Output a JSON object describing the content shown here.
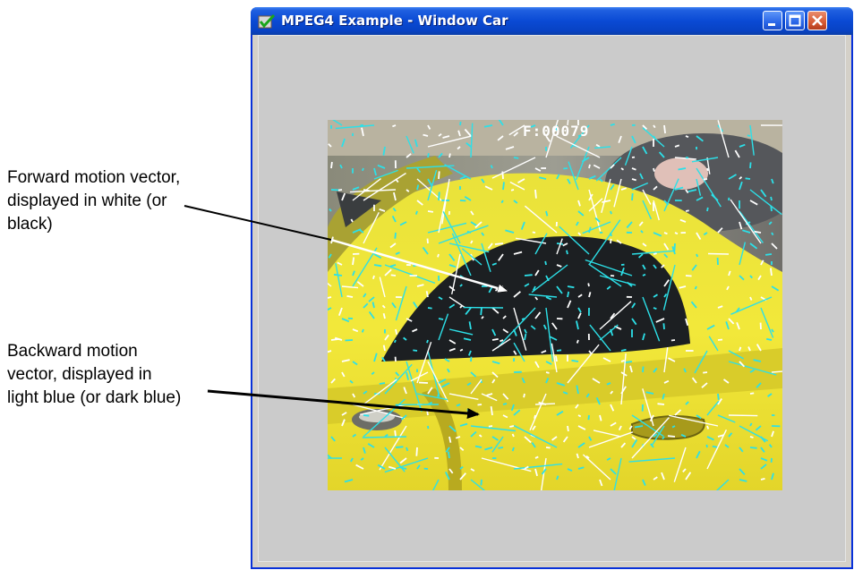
{
  "window": {
    "title": "MPEG4 Example - Window Car",
    "icon": "app-checkmark-icon",
    "buttons": [
      "minimize-icon",
      "maximize-icon",
      "close-icon"
    ]
  },
  "video": {
    "frame_label": "F:00079"
  },
  "annotations": {
    "forward": "Forward motion vector,\ndisplayed in white (or\nblack)",
    "backward": "Backward motion\nvector, displayed in\nlight blue (or dark blue)"
  },
  "colors": {
    "forward_vector": "#ffffff",
    "backward_vector": "#2ce0e8",
    "titlebar": "#0a4ad4",
    "client_bg": "#cbcbcb"
  }
}
